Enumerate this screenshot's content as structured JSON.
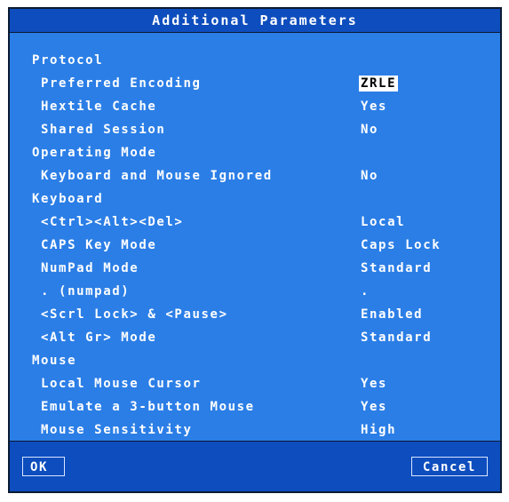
{
  "dialog": {
    "title": "Additional Parameters",
    "rows": [
      {
        "type": "section",
        "label": "Protocol"
      },
      {
        "type": "item",
        "label": "Preferred Encoding",
        "value": "ZRLE",
        "selected": true
      },
      {
        "type": "item",
        "label": "Hextile Cache",
        "value": "Yes"
      },
      {
        "type": "item",
        "label": "Shared Session",
        "value": "No"
      },
      {
        "type": "section",
        "label": "Operating Mode"
      },
      {
        "type": "item",
        "label": "Keyboard and Mouse Ignored",
        "value": "No"
      },
      {
        "type": "section",
        "label": "Keyboard"
      },
      {
        "type": "item",
        "label": "<Ctrl><Alt><Del>",
        "value": "Local"
      },
      {
        "type": "item",
        "label": "CAPS Key Mode",
        "value": "Caps Lock"
      },
      {
        "type": "item",
        "label": "NumPad Mode",
        "value": "Standard"
      },
      {
        "type": "item",
        "label": ". (numpad)",
        "value": "."
      },
      {
        "type": "item",
        "label": "<Scrl Lock> & <Pause>",
        "value": "Enabled"
      },
      {
        "type": "item",
        "label": "<Alt Gr> Mode",
        "value": "Standard"
      },
      {
        "type": "section",
        "label": "Mouse"
      },
      {
        "type": "item",
        "label": "Local Mouse Cursor",
        "value": "Yes"
      },
      {
        "type": "item",
        "label": "Emulate a 3-button Mouse",
        "value": "Yes"
      },
      {
        "type": "item",
        "label": "Mouse Sensitivity",
        "value": "High"
      }
    ],
    "buttons": {
      "ok_label": "OK",
      "cancel_label": "Cancel"
    },
    "colors": {
      "background": "#2b7ee6",
      "titlebar": "#0d4dbe",
      "text": "#ffffff",
      "highlight": "#ffffff"
    }
  }
}
